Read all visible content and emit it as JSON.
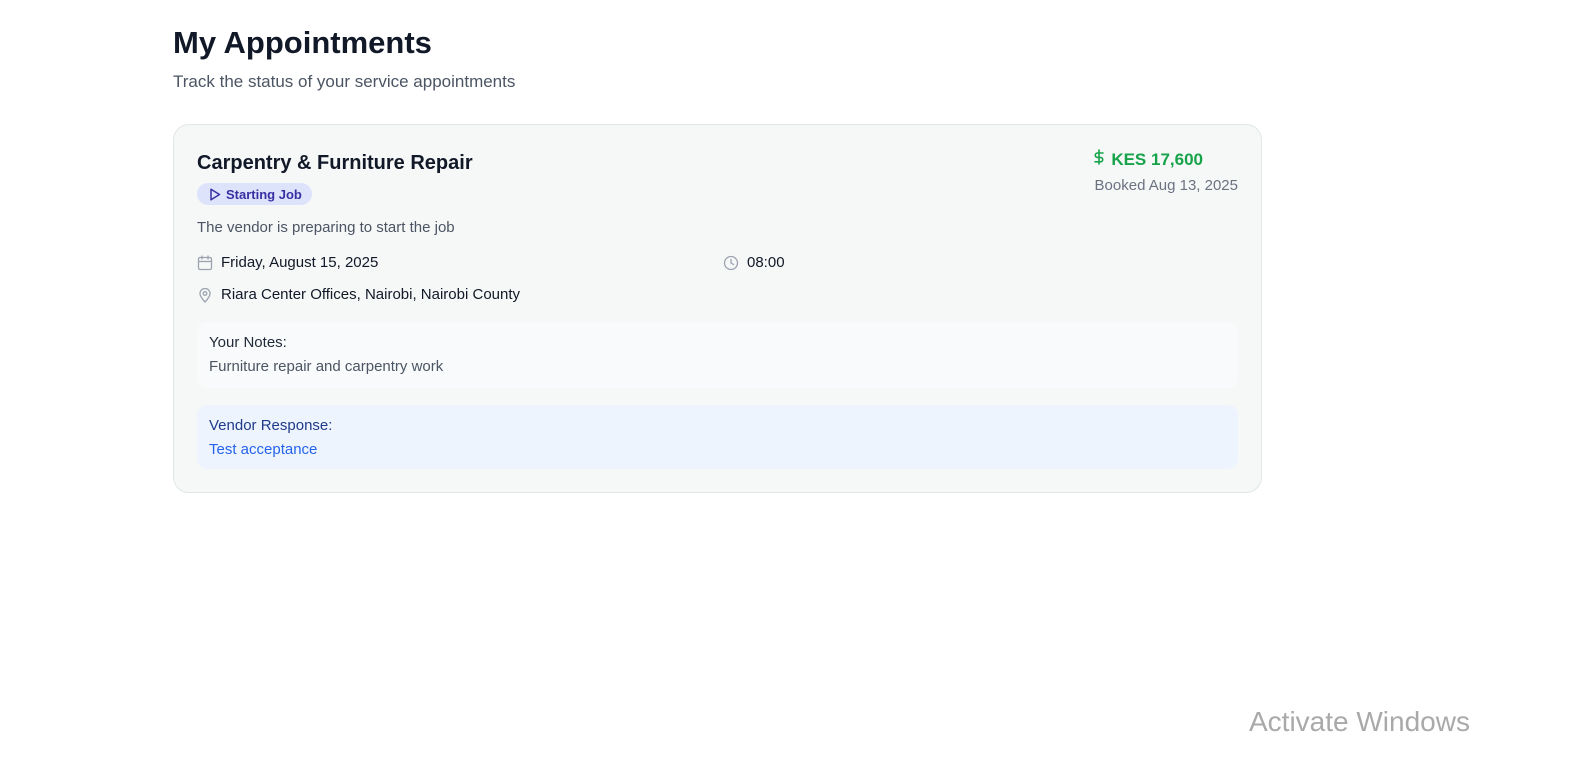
{
  "header": {
    "title": "My Appointments",
    "subtitle": "Track the status of your service appointments"
  },
  "appointment": {
    "service": "Carpentry & Furniture Repair",
    "status": {
      "label": "Starting Job",
      "icon": "play-icon",
      "color": "#3730a3",
      "background": "#dde3fb"
    },
    "status_description": "The vendor is preparing to start the job",
    "date": {
      "icon": "calendar-icon",
      "value": "Friday, August 15, 2025"
    },
    "time": {
      "icon": "clock-icon",
      "value": "08:00"
    },
    "location": {
      "icon": "map-pin-icon",
      "value": "Riara Center Offices, Nairobi, Nairobi County"
    },
    "price": {
      "icon": "dollar-icon",
      "value": "KES 17,600",
      "color": "#16a34a"
    },
    "booked": "Booked Aug 13, 2025",
    "notes": {
      "label": "Your Notes:",
      "text": "Furniture repair and carpentry work"
    },
    "vendor_response": {
      "label": "Vendor Response:",
      "text": "Test acceptance"
    }
  },
  "os_watermark": "Activate Windows"
}
